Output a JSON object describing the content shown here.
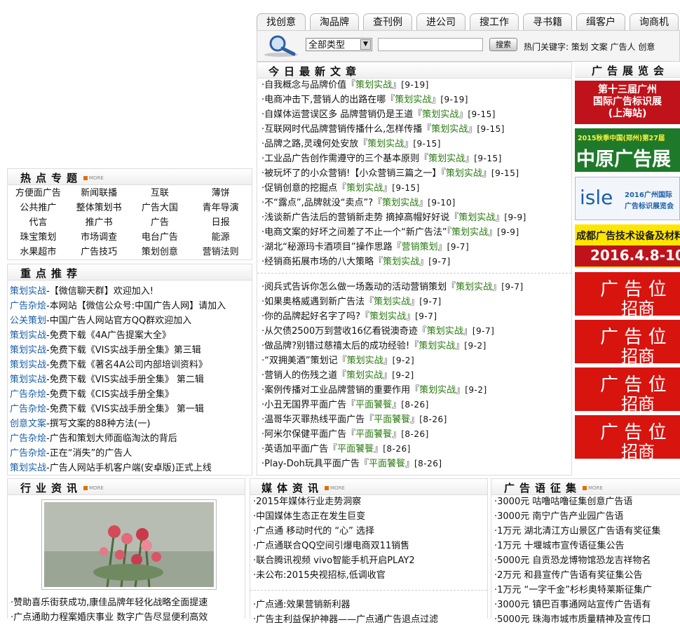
{
  "tabs": [
    "找创意",
    "淘品牌",
    "查刊例",
    "进公司",
    "搜工作",
    "寻书籍",
    "缉客户",
    "询商机"
  ],
  "search": {
    "select_value": "全部类型",
    "button_label": "搜索",
    "hot_prefix": "热门关键字:",
    "hot_keywords": "策划 文案 广告人 创意"
  },
  "hot_topics": {
    "title": "热点专题",
    "more": "MORE",
    "rows": [
      [
        "方便面广告",
        "新闻联播",
        "互联",
        "薄饼"
      ],
      [
        "公共推广",
        "整体策划书",
        "广告大国",
        "青年导演"
      ],
      [
        "代言",
        "推广书",
        "广告",
        "日报"
      ],
      [
        "珠宝策划",
        "市场调查",
        "电台广告",
        "能源"
      ],
      [
        "水果超市",
        "广告技巧",
        "策划创意",
        "营销法则"
      ]
    ]
  },
  "recommend": {
    "title": "重点推荐",
    "items": [
      {
        "cat": "策划实战",
        "text": "【微信聊天群】欢迎加入!"
      },
      {
        "cat": "广告杂烩",
        "text": "本网站【微信公众号:中国广告人网】请加入"
      },
      {
        "cat": "公关策划",
        "text": "中国广告人网站官方QQ群欢迎加入"
      },
      {
        "cat": "策划实战",
        "text": "免费下载《4A广告提案大全》"
      },
      {
        "cat": "策划实战",
        "text": "免费下载《VIS实战手册全集》第三辑"
      },
      {
        "cat": "策划实战",
        "text": "免费下载《著名4A公司内部培训资料》"
      },
      {
        "cat": "策划实战",
        "text": "免费下载《VIS实战手册全集》 第二辑"
      },
      {
        "cat": "广告杂烩",
        "text": "免费下载《CIS实战手册全集》"
      },
      {
        "cat": "广告杂烩",
        "text": "免费下载《VIS实战手册全集》 第一辑"
      },
      {
        "cat": "创意文案",
        "text": "撰写文案的88种方法(一)"
      },
      {
        "cat": "广告杂烩",
        "text": "广告和策划大师面临淘汰的背后"
      },
      {
        "cat": "广告杂烩",
        "text": "正在“消失”的广告人"
      },
      {
        "cat": "策划实战",
        "text": "广告人网站手机客户端(安卓版)正式上线"
      }
    ]
  },
  "today": {
    "title": "今日最新文章",
    "group1": [
      {
        "text": "·自我概念与品牌价值",
        "tag": "策划实战",
        "date": "9-19"
      },
      {
        "text": "·电商冲击下,营销人的出路在哪",
        "tag": "策划实战",
        "date": "9-19"
      },
      {
        "text": "·自媒体运营误区多 品牌营销仍是王道",
        "tag": "策划实战",
        "date": "9-15"
      },
      {
        "text": "·互联网时代品牌营销传播什么,怎样传播",
        "tag": "策划实战",
        "date": "9-15"
      },
      {
        "text": "·品牌之路,灵魂何处安放",
        "tag": "策划实战",
        "date": "9-15"
      },
      {
        "text": "·工业品广告创作需遵守的三个基本原则",
        "tag": "策划实战",
        "date": "9-15"
      },
      {
        "text": "·被玩坏了的小众营销!【小众营销三篇之一】",
        "tag": "策划实战",
        "date": "9-15"
      },
      {
        "text": "·促销创意的挖掘点",
        "tag": "策划实战",
        "date": "9-15"
      },
      {
        "text": "·不“露点”,品牌就没“卖点”?",
        "tag": "策划实战",
        "date": "9-10"
      },
      {
        "text": "·浅谈新广告法后的营销新走势 摘掉高帽好好说",
        "tag": "策划实战",
        "date": "9-9"
      },
      {
        "text": "·电商文案的好坏之间差了不止一个“新广告法”",
        "tag": "策划实战",
        "date": "9-9"
      },
      {
        "text": "·湖北“秘源玛卡酒项目”操作思路",
        "tag": "营销策划",
        "date": "9-7"
      },
      {
        "text": "·经销商拓展市场的八大策略",
        "tag": "策划实战",
        "date": "9-7"
      }
    ],
    "group2": [
      {
        "text": "·阅兵式告诉你怎么做一场轰动的活动营销策划",
        "tag": "策划实战",
        "date": "9-7"
      },
      {
        "text": "·如果奥格威遇到新广告法",
        "tag": "策划实战",
        "date": "9-7"
      },
      {
        "text": "·你的品牌起好名字了吗?",
        "tag": "策划实战",
        "date": "9-7"
      },
      {
        "text": "·从欠债2500万到营收16亿看锐澳奇迹",
        "tag": "策划实战",
        "date": "9-7"
      },
      {
        "text": "·做品牌?别错过慈禧太后的成功经验!",
        "tag": "策划实战",
        "date": "9-2"
      },
      {
        "text": "·“双拥美酒”策划记",
        "tag": "策划实战",
        "date": "9-2"
      },
      {
        "text": "·营销人的伤残之道",
        "tag": "策划实战",
        "date": "9-2"
      },
      {
        "text": "·案例传播对工业品牌营销的重要作用",
        "tag": "策划实战",
        "date": "9-2"
      },
      {
        "text": "·小丑无国界平面广告",
        "tag": "平面饕餮",
        "date": "8-26"
      },
      {
        "text": "·温哥华灭罪热线平面广告",
        "tag": "平面饕餮",
        "date": "8-26"
      },
      {
        "text": "·阿米尔保健平面广告",
        "tag": "平面饕餮",
        "date": "8-26"
      },
      {
        "text": "·英语加平面广告",
        "tag": "平面饕餮",
        "date": "8-26"
      },
      {
        "text": "·Play-Doh玩具平面广告",
        "tag": "平面饕餮",
        "date": "8-26"
      }
    ]
  },
  "ads": {
    "title": "广告展览会",
    "b1": [
      "第十三届广州",
      "国际广告标识展",
      "(上海站)"
    ],
    "b2": [
      "2015秋季中国(郑州)第27届",
      "中原广告展"
    ],
    "b3": [
      "isle",
      "2016广州国际",
      "广告标识展览会"
    ],
    "b4": [
      "成都广告技术设备及材料展",
      "2016.4.8-10"
    ],
    "slot": [
      "广",
      "告",
      "位",
      "招",
      "商"
    ]
  },
  "industry": {
    "title": "行业资讯",
    "more": "MORE",
    "items": [
      "·赞助喜乐街获成功,康佳品牌年轻化战略全面提速",
      "·广点通助力程案婚庆事业 数字广告尽显便利高效"
    ]
  },
  "media": {
    "title": "媒体资讯",
    "more": "MORE",
    "items": [
      "·2015年媒体行业走势洞察",
      "·中国媒体生态正在发生巨变",
      "·广点通 移动时代的 “心” 选择",
      "·广点通联合QQ空间引爆电商双11销售",
      "·联合腾讯视频 vivo智能手机开启PLAY2",
      "·未公布:2015央视招标,低调收官"
    ],
    "items2": [
      "·广点通:效果营销新利器",
      "·广告主利益保护神器——广点通广告退点过滤"
    ]
  },
  "slogans": {
    "title": "广告语征集",
    "more": "MORE",
    "items": [
      "·3000元 咕噜咕噜征集创意广告语",
      "·3000元 南宁广告产业园广告语",
      "·1万元 湖北清江方山景区广告语有奖征集",
      "·1万元 十堰城市宣传语征集公告",
      "·5000元 自贡恐龙博物馆恐龙吉祥物名",
      "·2万元 和县宣传广告语有奖征集公告",
      "·1万元 “一字千金”杉杉奥特莱斯征集广",
      "·3000元 镇巴百事通网站宣传广告语有",
      "·5000元 珠海市城市质量精神及宣传口"
    ]
  }
}
